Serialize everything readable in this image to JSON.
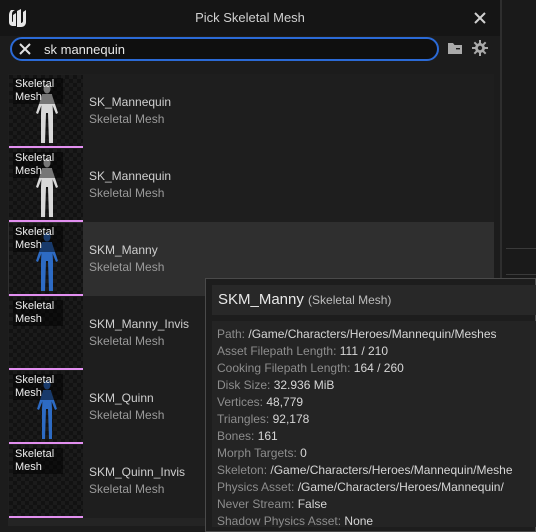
{
  "window": {
    "title": "Pick Skeletal Mesh"
  },
  "search": {
    "value": "sk mannequin"
  },
  "icons": {
    "logo": "unreal-logo-icon",
    "close": "close-icon",
    "clear": "clear-search-icon",
    "folder": "folder-icon",
    "settings": "gear-icon"
  },
  "assets": [
    {
      "thumb_label": "Skeletal Mesh",
      "name": "SK_Mannequin",
      "type": "Skeletal Mesh",
      "color": "#d8d8d8"
    },
    {
      "thumb_label": "Skeletal Mesh",
      "name": "SK_Mannequin",
      "type": "Skeletal Mesh",
      "color": "#d8d8d8"
    },
    {
      "thumb_label": "Skeletal Mesh",
      "name": "SKM_Manny",
      "type": "Skeletal Mesh",
      "color": "#2d6bc4"
    },
    {
      "thumb_label": "Skeletal Mesh",
      "name": "SKM_Manny_Invis",
      "type": "Skeletal Mesh",
      "color": ""
    },
    {
      "thumb_label": "Skeletal Mesh",
      "name": "SKM_Quinn",
      "type": "Skeletal Mesh",
      "color": "#2d6bc4"
    },
    {
      "thumb_label": "Skeletal Mesh",
      "name": "SKM_Quinn_Invis",
      "type": "Skeletal Mesh",
      "color": ""
    }
  ],
  "tooltip": {
    "title": "SKM_Manny",
    "subtitle": "(Skeletal Mesh)",
    "fields": [
      {
        "key": "Path:",
        "value": "/Game/Characters/Heroes/Mannequin/Meshes"
      },
      {
        "key": "Asset Filepath Length:",
        "value": "111 / 210"
      },
      {
        "key": "Cooking Filepath Length:",
        "value": "164 / 260"
      },
      {
        "key": "Disk Size:",
        "value": "32.936 MiB"
      },
      {
        "key": "Vertices:",
        "value": "48,779"
      },
      {
        "key": "Triangles:",
        "value": "92,178"
      },
      {
        "key": "Bones:",
        "value": "161"
      },
      {
        "key": "Morph Targets:",
        "value": "0"
      },
      {
        "key": "Skeleton:",
        "value": "/Game/Characters/Heroes/Mannequin/Meshe"
      },
      {
        "key": "Physics Asset:",
        "value": "/Game/Characters/Heroes/Mannequin/"
      },
      {
        "key": "Never Stream:",
        "value": "False"
      },
      {
        "key": "Shadow Physics Asset:",
        "value": "None"
      }
    ]
  },
  "colors": {
    "accent": "#2b6ad6",
    "thumb_bar": "#e28ff0"
  }
}
